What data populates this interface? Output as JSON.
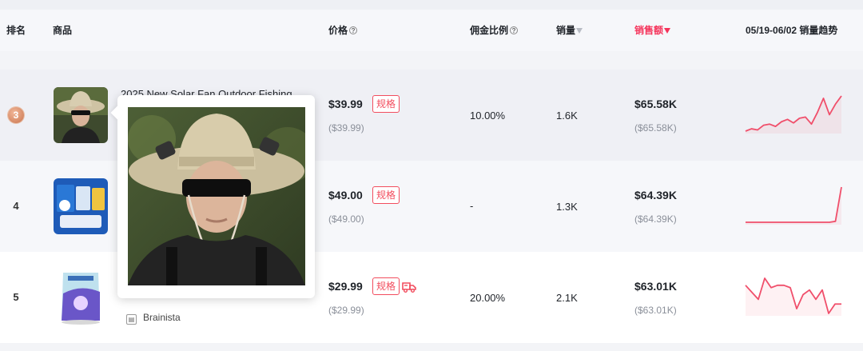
{
  "header": {
    "rank": "排名",
    "product": "商品",
    "price": "价格",
    "commission": "佣金比例",
    "sales": "销量",
    "revenue": "销售额",
    "trend": "05/19-06/02 销量趋势",
    "help_glyph": "?"
  },
  "rows": [
    {
      "rank": "3",
      "title": "2025 New Solar Fan Outdoor Fishing",
      "price": "$39.99",
      "price_sub": "($39.99)",
      "spec": "规格",
      "commission": "10.00%",
      "sales": "1.6K",
      "revenue": "$65.58K",
      "revenue_sub": "($65.58K)",
      "trend": [
        12,
        14,
        13,
        17,
        18,
        16,
        20,
        22,
        19,
        23,
        24,
        18,
        28,
        40,
        26,
        35,
        42
      ]
    },
    {
      "rank": "4",
      "title": "",
      "price": "$49.00",
      "price_sub": "($49.00)",
      "spec": "规格",
      "commission": "-",
      "sales": "1.3K",
      "revenue": "$64.39K",
      "revenue_sub": "($64.39K)",
      "trend": [
        5,
        5,
        5,
        5,
        5,
        5,
        5,
        5,
        5,
        5,
        5,
        5,
        5,
        5,
        5,
        6,
        42
      ]
    },
    {
      "rank": "5",
      "title": "",
      "price": "$29.99",
      "price_sub": "($29.99)",
      "spec": "规格",
      "commission": "20.00%",
      "sales": "2.1K",
      "revenue": "$63.01K",
      "revenue_sub": "($63.01K)",
      "shop": "Brainista",
      "trend": [
        34,
        28,
        22,
        40,
        32,
        34,
        34,
        32,
        14,
        26,
        30,
        22,
        30,
        10,
        18,
        18
      ]
    }
  ],
  "colors": {
    "accent": "#f5335a",
    "spark": "#f04f6b",
    "spec_border": "#f24d5e"
  }
}
